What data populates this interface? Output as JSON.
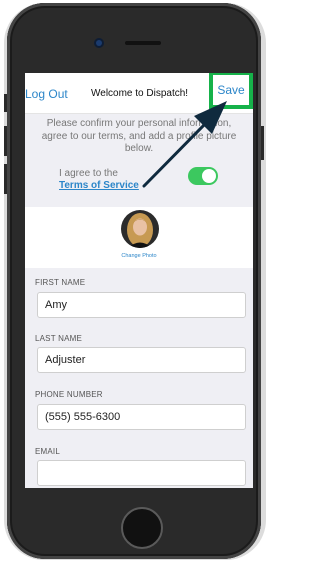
{
  "navbar": {
    "logout_label": "Log Out",
    "title": "Welcome to Dispatch!",
    "save_label": "Save"
  },
  "intro": {
    "message": "Please confirm your personal information, agree to our terms, and add a profile picture below.",
    "agree_label": "I agree to the",
    "terms_link": "Terms of Service",
    "terms_toggle_on": true
  },
  "profile": {
    "change_photo_label": "Change Photo"
  },
  "form": {
    "first_name": {
      "label": "FIRST NAME",
      "value": "Amy"
    },
    "last_name": {
      "label": "LAST NAME",
      "value": "Adjuster"
    },
    "phone": {
      "label": "PHONE NUMBER",
      "value": "(555) 555-6300"
    },
    "email": {
      "label": "EMAIL",
      "value": ""
    }
  },
  "colors": {
    "accent": "#2c86c9",
    "highlight": "#16b24a",
    "toggle_on": "#3cc85f",
    "arrow": "#0f2a3e"
  }
}
